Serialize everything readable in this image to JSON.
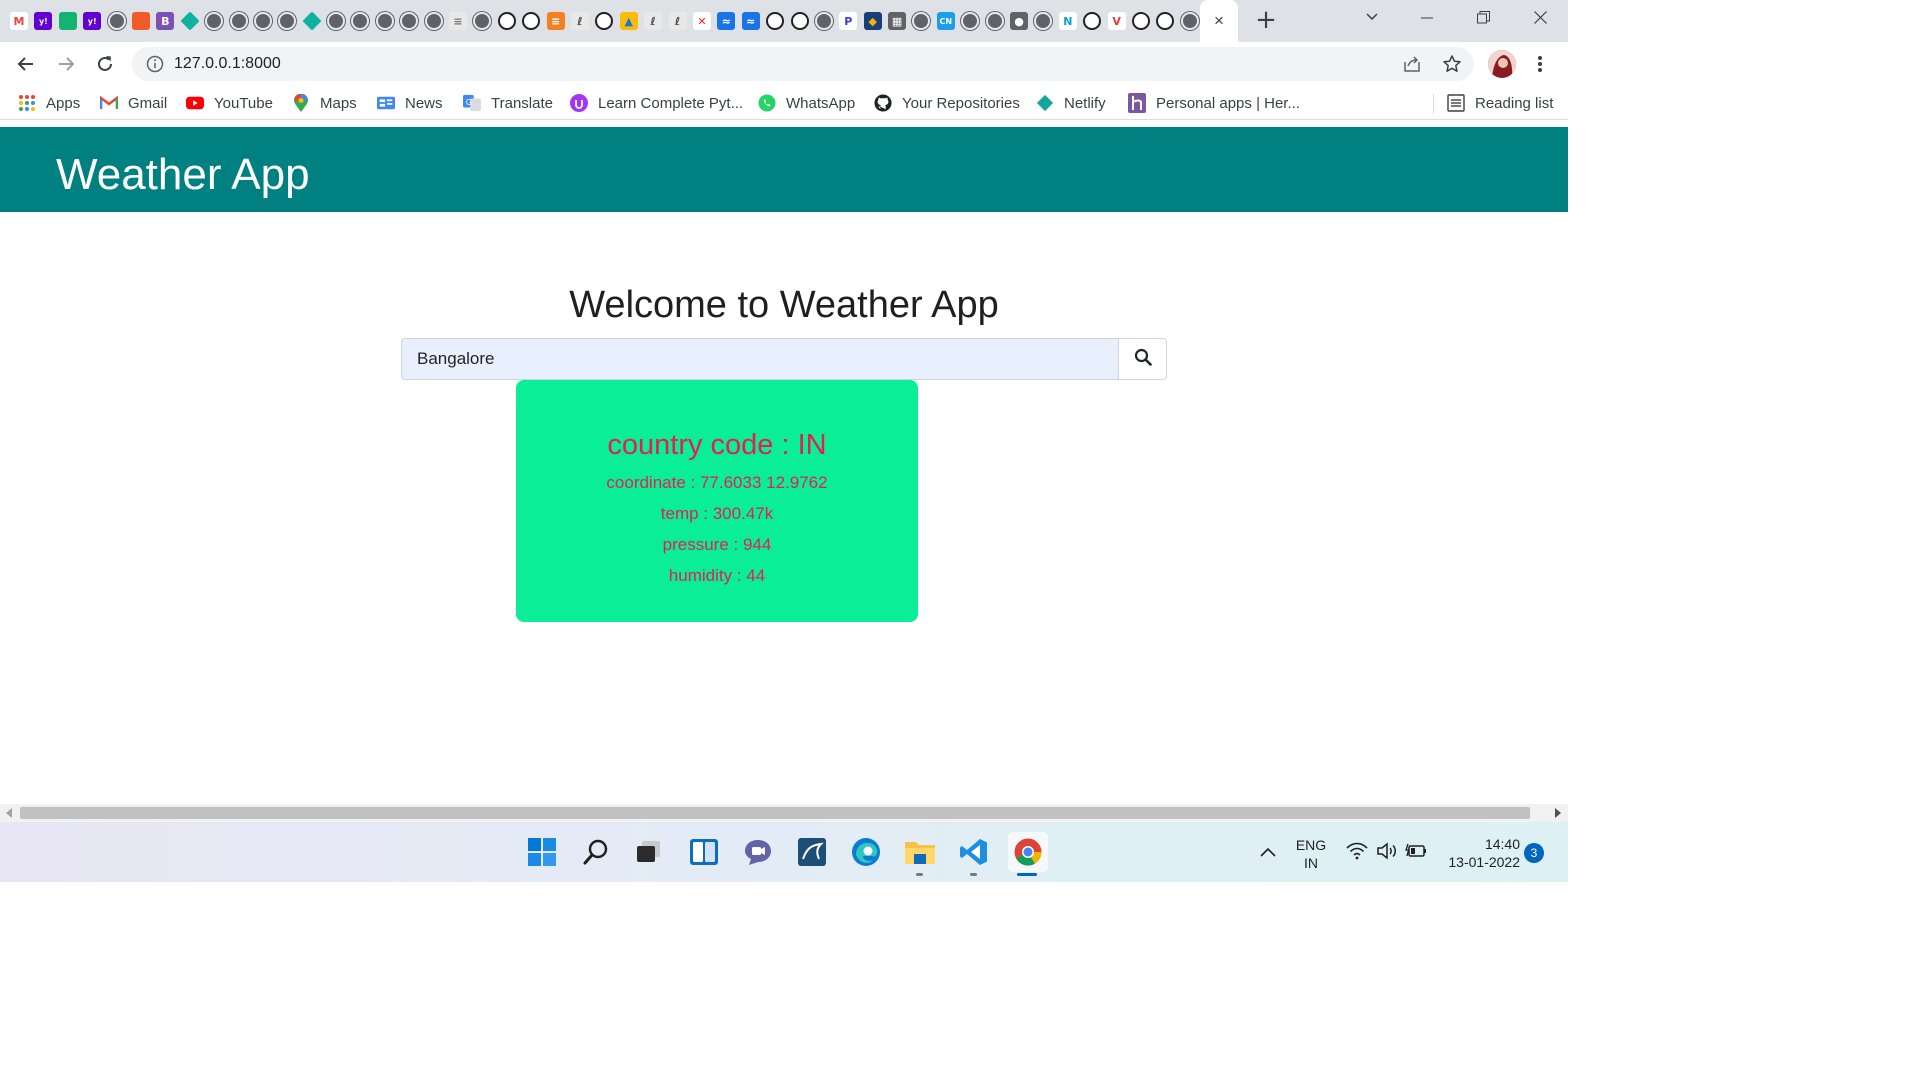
{
  "browser": {
    "address_url": "127.0.0.1:8000",
    "tab_close_glyph": "×",
    "new_tab_glyph": "+",
    "tab_favicons": [
      "gmail-icon",
      "yahoo-icon",
      "green-shield-icon",
      "yahoo-icon",
      "globe-icon",
      "red-grid-icon",
      "bootstrap-icon",
      "diamond-icon",
      "globe-icon",
      "globe-icon",
      "globe-icon",
      "globe-icon",
      "diamond-icon",
      "globe-icon",
      "globe-icon",
      "globe-icon",
      "globe-icon",
      "globe-icon",
      "stack-icon",
      "globe-icon",
      "github-icon",
      "github-icon",
      "stackoverflow-icon",
      "leaf-icon",
      "github-icon",
      "drive-icon",
      "leaf-icon",
      "leaf-icon",
      "cross-icon",
      "blue-box-icon",
      "blue-box-icon",
      "github-icon",
      "github-icon",
      "globe-icon",
      "p-icon",
      "shield-icon",
      "dark-grid-icon",
      "globe-icon",
      "cn-icon",
      "globe-icon",
      "globe-icon",
      "chrome-icon",
      "globe-icon",
      "n-icon",
      "github-icon",
      "v-icon",
      "github-icon",
      "github-icon",
      "globe-icon",
      "github-icon"
    ],
    "bookmarks": [
      {
        "label": "Apps",
        "icon": "apps-grid-icon"
      },
      {
        "label": "Gmail",
        "icon": "gmail-icon"
      },
      {
        "label": "YouTube",
        "icon": "youtube-icon"
      },
      {
        "label": "Maps",
        "icon": "maps-pin-icon"
      },
      {
        "label": "News",
        "icon": "news-icon"
      },
      {
        "label": "Translate",
        "icon": "translate-icon"
      },
      {
        "label": "Learn Complete Pyt...",
        "icon": "course-icon"
      },
      {
        "label": "WhatsApp",
        "icon": "whatsapp-icon"
      },
      {
        "label": "Your Repositories",
        "icon": "github-icon"
      },
      {
        "label": "Netlify",
        "icon": "netlify-icon"
      },
      {
        "label": "Personal apps | Her...",
        "icon": "heroku-icon"
      }
    ],
    "reading_list": "Reading list"
  },
  "app": {
    "header_title": "Weather App",
    "welcome": "Welcome to Weather App",
    "search_value": "Bangalore",
    "card": {
      "title": "country code : IN",
      "coordinate": "coordinate : 77.6033 12.9762",
      "temp": "temp : 300.47k",
      "pressure": "pressure : 944",
      "humidity": "humidity : 44"
    }
  },
  "taskbar": {
    "apps": [
      "windows-start-icon",
      "search-icon",
      "task-view-icon",
      "widgets-icon",
      "teams-chat-icon",
      "mysql-workbench-icon",
      "edge-icon",
      "file-explorer-icon",
      "vscode-icon",
      "chrome-icon"
    ],
    "lang_line1": "ENG",
    "lang_line2": "IN",
    "time": "14:40",
    "date": "13-01-2022",
    "notification_count": "3"
  },
  "colors": {
    "header_bg": "#008080",
    "card_bg": "#0aef97",
    "card_text": "#e0224f"
  }
}
